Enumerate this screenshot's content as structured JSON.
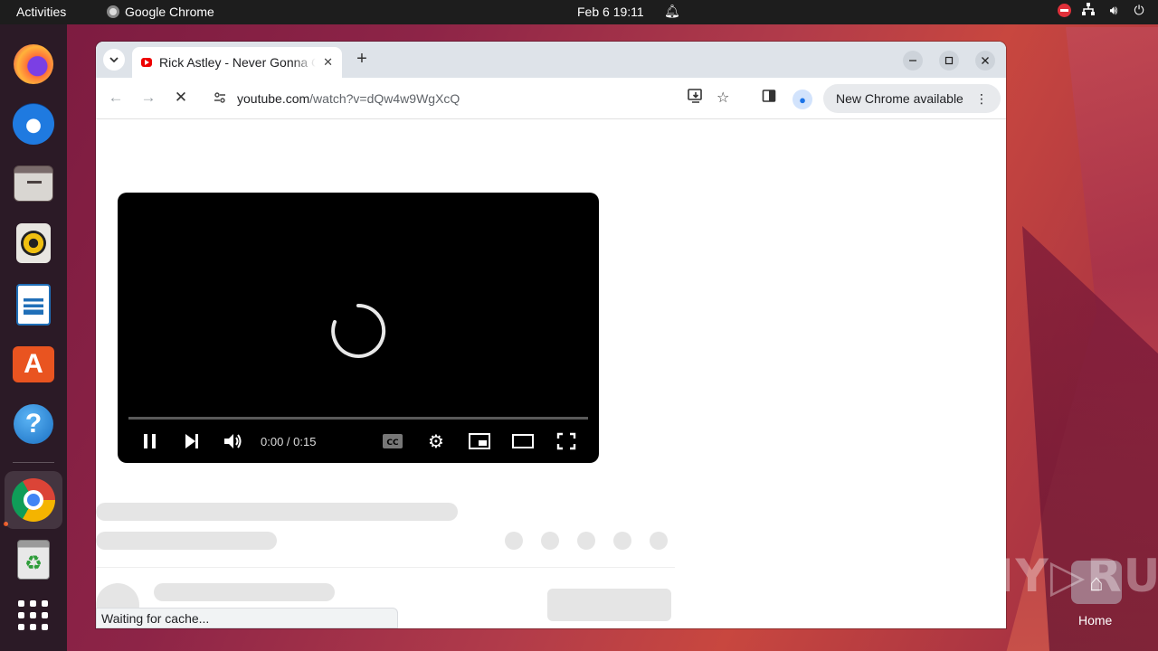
{
  "topbar": {
    "activities": "Activities",
    "app_name": "Google Chrome",
    "datetime": "Feb 6  19:11"
  },
  "dock": {
    "items": [
      "firefox",
      "thunderbird",
      "files",
      "rhythmbox",
      "libreoffice-writer",
      "app-center",
      "help",
      "google-chrome",
      "trash",
      "show-apps"
    ]
  },
  "browser": {
    "tab": {
      "title": "Rick Astley - Never Gonna Give You Up",
      "close_glyph": "✕"
    },
    "new_tab_glyph": "+",
    "omnibox": {
      "host": "youtube.com",
      "path": "/watch?v=dQw4w9WgXcQ"
    },
    "update_chip": {
      "label": "New Chrome available",
      "menu_glyph": "⋮"
    },
    "status_text": "Waiting for cache..."
  },
  "player": {
    "time": "0:00 / 0:15",
    "progress_fraction": 0.0,
    "state": "loading"
  },
  "desktop": {
    "watermark": "ANY▷RUN",
    "home_label": "Home"
  },
  "colors": {
    "topbar": "#1d1d1d",
    "dock": "#2b1a26",
    "tabstrip": "#dee3e9",
    "accent_youtube": "#ff0000",
    "ubuntu_orange": "#e95420"
  }
}
